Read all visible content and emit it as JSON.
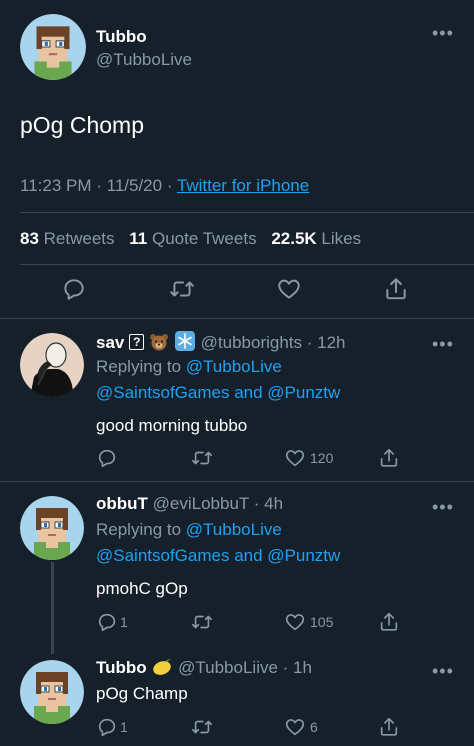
{
  "main_tweet": {
    "name": "Tubbo",
    "handle": "@TubboLive",
    "text": "pOg Chomp",
    "time": "11:23 PM",
    "date": "11/5/20",
    "source": "Twitter for iPhone",
    "stats": {
      "retweets_count": "83",
      "retweets_label": "Retweets",
      "quotes_count": "11",
      "quotes_label": "Quote Tweets",
      "likes_count": "22.5K",
      "likes_label": "Likes"
    }
  },
  "replies": [
    {
      "name": "sav",
      "badge": "?",
      "handle": "@tubborights",
      "age": "12h",
      "replying_prefix": "Replying to",
      "replying_first": "@TubboLive",
      "replying_rest": "@SaintsofGames and @Punztw",
      "text": "good morning tubbo",
      "reply_count": "",
      "retweet_count": "",
      "like_count": "120"
    },
    {
      "name": "obbuT",
      "handle": "@eviLobbuT",
      "age": "4h",
      "replying_prefix": "Replying to",
      "replying_first": "@TubboLive",
      "replying_rest": "@SaintsofGames and @Punztw",
      "text": "pmohC gOp",
      "reply_count": "1",
      "retweet_count": "",
      "like_count": "105"
    },
    {
      "name": "Tubbo",
      "handle": "@TubboLiive",
      "age": "1h",
      "text": "pOg Champ",
      "reply_count": "1",
      "retweet_count": "",
      "like_count": "6"
    }
  ],
  "colors": {
    "background": "#15202b",
    "accent": "#1da1f2",
    "muted": "#8899a6",
    "divider": "#38444d"
  },
  "icons": [
    "more-icon",
    "reply-icon",
    "retweet-icon",
    "like-icon",
    "share-icon",
    "bear-emoji",
    "snowflake-emoji",
    "lemon-emoji"
  ]
}
